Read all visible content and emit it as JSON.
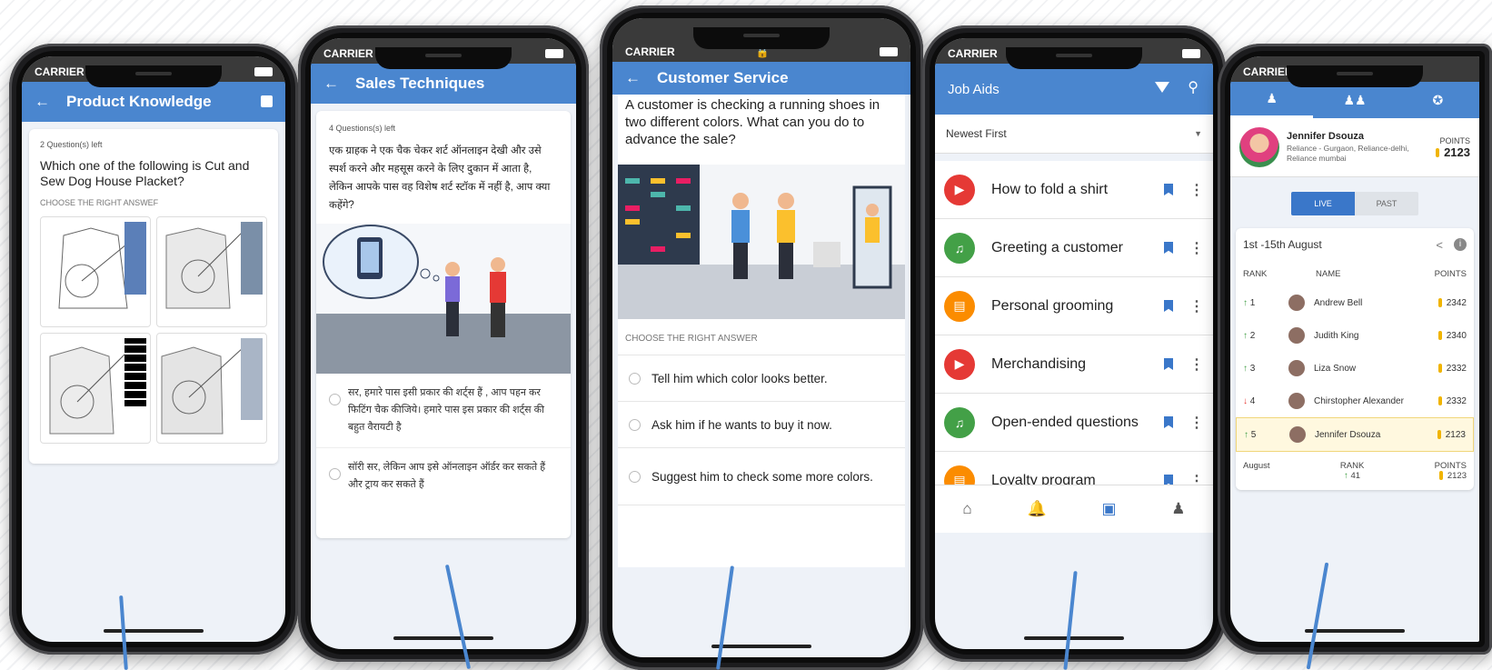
{
  "status": {
    "carrier": "CARRIER"
  },
  "p1": {
    "title": "Product Knowledge",
    "questions_left": "2 Question(s) left",
    "question": "Which one of the following is Cut and Sew Dog House Placket?",
    "choose": "CHOOSE THE RIGHT ANSWEF"
  },
  "p2": {
    "title": "Sales Techniques",
    "questions_left": "4 Questions(s) left",
    "question": "एक ग्राहक ने एक चैक चेकर शर्ट ऑनलाइन देखी और उसे स्पर्श करने और महसूस करने के लिए दुकान में आता है, लेकिन आपके पास वह विशेष शर्ट स्टॉक में नहीं है, आप क्या कहेंगे?",
    "options": [
      "सर, हमारे पास इसी प्रकार की शर्ट्स हैं , आप पहन कर फिटिंग चैक कीजिये। हमारे पास इस प्रकार की शर्ट्स की बहुत वैरायटी है",
      "सॉरी सर, लेकिन आप इसे ऑनलाइन ऑर्डर कर सकते हैं और ट्राय कर सकते हैं"
    ]
  },
  "p3": {
    "title": "Customer Service",
    "question": "A customer is checking a running shoes in two different colors. What can you do to advance the sale?",
    "choose": "CHOOSE THE RIGHT ANSWER",
    "options": [
      "Tell him which color looks better.",
      "Ask him if he wants to buy it now.",
      "Suggest him to check some more colors."
    ]
  },
  "p4": {
    "title": "Job Aids",
    "sort": "Newest First",
    "items": [
      {
        "label": "How to fold a shirt",
        "icon": "video-icon",
        "color": "#e53935"
      },
      {
        "label": "Greeting a customer",
        "icon": "audio-icon",
        "color": "#43a047"
      },
      {
        "label": "Personal grooming",
        "icon": "document-icon",
        "color": "#fb8c00"
      },
      {
        "label": "Merchandising",
        "icon": "video-icon",
        "color": "#e53935"
      },
      {
        "label": "Open-ended questions",
        "icon": "audio-icon",
        "color": "#43a047"
      },
      {
        "label": "Loyalty program",
        "icon": "document-icon",
        "color": "#fb8c00"
      }
    ]
  },
  "p5": {
    "user": {
      "name": "Jennifer Dsouza",
      "org": "Reliance - Gurgaon, Reliance-delhi, Reliance mumbai",
      "points_label": "POINTS",
      "points": "2123"
    },
    "toggle": {
      "live": "LIVE",
      "past": "PAST"
    },
    "period": "1st -15th August",
    "headers": {
      "rank": "RANK",
      "name": "NAME",
      "points": "POINTS"
    },
    "rows": [
      {
        "rank": "1",
        "name": "Andrew Bell",
        "points": "2342",
        "trend": "up"
      },
      {
        "rank": "2",
        "name": "Judith King",
        "points": "2340",
        "trend": "up"
      },
      {
        "rank": "3",
        "name": "Liza Snow",
        "points": "2332",
        "trend": "up"
      },
      {
        "rank": "4",
        "name": "Chirstopher Alexander",
        "points": "2332",
        "trend": "down"
      },
      {
        "rank": "5",
        "name": "Jennifer Dsouza",
        "points": "2123",
        "trend": "up"
      }
    ],
    "summary": {
      "month": "August",
      "rank_label": "RANK",
      "rank": "41",
      "points_label": "POINTS",
      "points": "2123"
    }
  }
}
